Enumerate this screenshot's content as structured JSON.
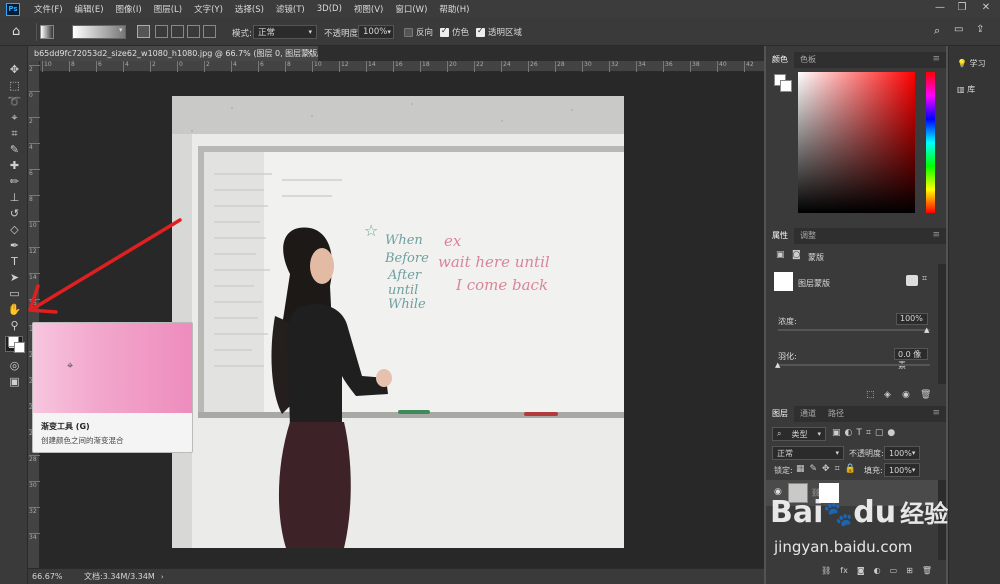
{
  "menubar": {
    "logo": "Ps",
    "items": [
      "文件(F)",
      "编辑(E)",
      "图像(I)",
      "图层(L)",
      "文字(Y)",
      "选择(S)",
      "滤镜(T)",
      "3D(D)",
      "视图(V)",
      "窗口(W)",
      "帮助(H)"
    ]
  },
  "options": {
    "mode_label": "模式:",
    "mode_value": "正常",
    "opacity_label": "不透明度:",
    "opacity_value": "100%",
    "reverse_label": "反向",
    "dither_label": "仿色",
    "transparency_label": "透明区域"
  },
  "document": {
    "tab_title": "b65dd9fc72053d2_size62_w1080_h1080.jpg @ 66.7% (图层 0, 图层蒙版/8) *",
    "tab_close": "×"
  },
  "status": {
    "zoom": "66.67%",
    "doc_info": "文档:3.34M/3.34M"
  },
  "ruler_top_ticks": [
    "10",
    "8",
    "6",
    "4",
    "2",
    "0",
    "2",
    "4",
    "6",
    "8",
    "10",
    "12",
    "14",
    "16",
    "18",
    "20",
    "22",
    "24",
    "26",
    "28",
    "30",
    "32",
    "34",
    "36",
    "38",
    "40",
    "42"
  ],
  "ruler_left_ticks": [
    "2",
    "0",
    "2",
    "4",
    "6",
    "8",
    "10",
    "12",
    "14",
    "16",
    "18",
    "20",
    "22",
    "24",
    "26",
    "28",
    "30",
    "32",
    "34"
  ],
  "whiteboard": {
    "green_lines": [
      "When",
      "Before",
      "After",
      "until",
      "While"
    ],
    "red_lines": [
      "ex",
      "wait here until",
      "I come back"
    ]
  },
  "tooltip": {
    "title": "渐变工具 (G)",
    "description": "创建颜色之间的渐变混合"
  },
  "panels": {
    "color_tabs": [
      "颜色",
      "色板"
    ],
    "properties_tabs": [
      "属性",
      "调整"
    ],
    "mask_label": "蒙版",
    "layer_mask_label": "图层蒙版",
    "density_label": "浓度:",
    "density_value": "100%",
    "feather_label": "羽化:",
    "feather_value": "0.0 像素",
    "layers_tabs": [
      "图层",
      "通道",
      "路径"
    ],
    "filter_kind": "类型",
    "blend_mode": "正常",
    "layer_opacity_label": "不透明度:",
    "layer_opacity_value": "100%",
    "lock_label": "锁定:",
    "fill_label": "填充:",
    "fill_value": "100%"
  },
  "far_panel": {
    "learn": "学习",
    "library": "库"
  },
  "watermark": {
    "brand": "Bai",
    "brand2": "du",
    "brand3": "经验",
    "url": "jingyan.baidu.com"
  },
  "colors": {
    "accent": "#31a8ff",
    "arrow": "#e02020",
    "tooltip_gradient_start": "#f7c6de",
    "tooltip_gradient_end": "#ee8cbd"
  }
}
